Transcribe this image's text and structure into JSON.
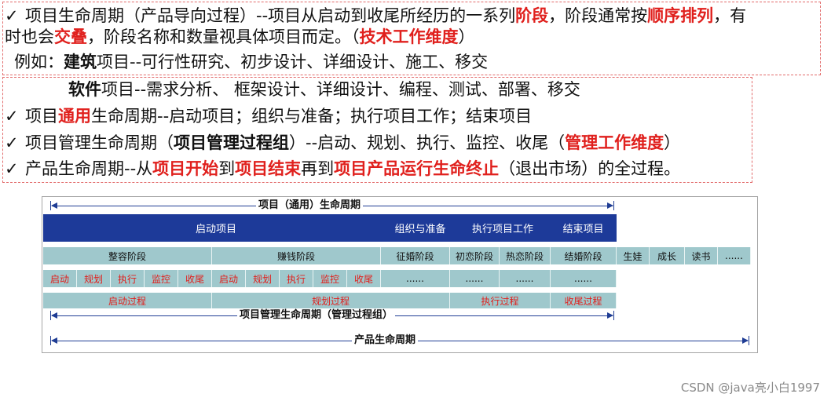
{
  "text": {
    "l1": {
      "a": "项目生命周期（产品导向过程）--项目从启动到收尾所经历的一系列",
      "b": "阶段",
      "c": "，阶段通常按",
      "d": "顺序排列",
      "e": "，有"
    },
    "l2": {
      "a": "时也会",
      "b": "交叠",
      "c": "，阶段名称和数量视具体项目而定。（",
      "d": "技术工作维度",
      "e": "）"
    },
    "l3": {
      "a": "例如：",
      "b": "建筑",
      "c": "项目--可行性研究、初步设计、详细设计、施工、移交"
    },
    "l4": {
      "a": "软件",
      "b": "项目--需求分析、  框架设计、详细设计、编程、测试、部署、移交"
    },
    "l5": {
      "a": "项目",
      "b": "通用",
      "c": "生命周期--启动项目；组织与准备；执行项目工作；结束项目"
    },
    "l6": {
      "a": "项目管理生命周期（",
      "b": "项目管理过程组",
      "c": "）--启动、规划、执行、监控、收尾（",
      "d": "管理工作维度",
      "e": "）"
    },
    "l7": {
      "a": "产品生命周期--从",
      "b": "项目开始",
      "c": "到",
      "d": "项目结束",
      "e": "再到",
      "f": "项目产品运行生命终止",
      "g": "（退出市场）的全过程。"
    },
    "check": "✓"
  },
  "diagram": {
    "top_label": "项目（通用）生命周期",
    "generic_phases": [
      "启动项目",
      "组织与准备",
      "执行项目工作",
      "结束项目"
    ],
    "stages": [
      "整容阶段",
      "赚钱阶段",
      "征婚阶段",
      "初恋阶段",
      "热恋阶段",
      "结婚阶段",
      "生娃",
      "成长",
      "读书",
      "......"
    ],
    "process_row": [
      "启动",
      "规划",
      "执行",
      "监控",
      "收尾",
      "启动",
      "规划",
      "执行",
      "监控",
      "收尾",
      "......",
      "......",
      "......",
      "......"
    ],
    "process_groups": [
      "启动过程",
      "规划过程",
      "执行过程",
      "收尾过程"
    ],
    "pm_label": "项目管理生命周期（管理过程组）",
    "product_label": "产品生命周期"
  },
  "watermark": "CSDN @java亮小白1997",
  "colors": {
    "accent_red": "#e0201d",
    "blue_bar": "#1d3a99",
    "teal": "#9fc8cc",
    "arrow": "#1f3d94",
    "dash": "#e26b6b"
  }
}
